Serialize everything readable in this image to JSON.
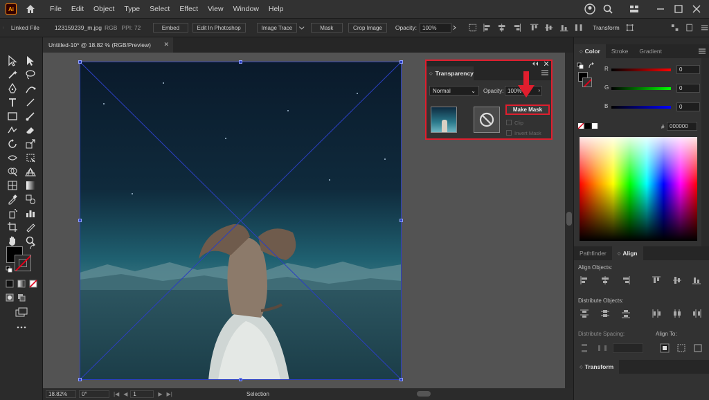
{
  "app": {
    "logo": "Ai"
  },
  "menu": [
    "File",
    "Edit",
    "Object",
    "Type",
    "Select",
    "Effect",
    "View",
    "Window",
    "Help"
  ],
  "controlbar": {
    "linked_file": "Linked File",
    "filename": "123159239_m.jpg",
    "color_mode": "RGB",
    "ppi": "PPI: 72",
    "embed": "Embed",
    "edit_photoshop": "Edit In Photoshop",
    "image_trace": "Image Trace",
    "mask": "Mask",
    "crop_image": "Crop Image",
    "opacity_label": "Opacity:",
    "opacity_value": "100%",
    "transform": "Transform"
  },
  "document": {
    "tab_title": "Untitled-10* @ 18.82 % (RGB/Preview)",
    "close": "✕"
  },
  "statusbar": {
    "zoom": "18.82%",
    "rotation": "0°",
    "artboard": "1",
    "tool": "Selection"
  },
  "transparency": {
    "title": "Transparency",
    "blend_mode": "Normal",
    "opacity_label": "Opacity:",
    "opacity_value": "100%",
    "make_mask": "Make Mask",
    "clip": "Clip",
    "invert_mask": "Invert Mask"
  },
  "color_panel": {
    "tabs": [
      "Color",
      "Stroke",
      "Gradient"
    ],
    "r_label": "R",
    "r_value": "0",
    "g_label": "G",
    "g_value": "0",
    "b_label": "B",
    "b_value": "0",
    "hex_label": "#",
    "hex_value": "000000"
  },
  "align_panel": {
    "tabs": [
      "Pathfinder",
      "Align"
    ],
    "align_objects": "Align Objects:",
    "distribute_objects": "Distribute Objects:",
    "distribute_spacing": "Distribute Spacing:",
    "align_to": "Align To:"
  },
  "transform_panel": {
    "title": "Transform"
  },
  "colors": {
    "highlight": "#e01e2e",
    "selection": "#2b3fc0",
    "accent": "#ff9a00"
  }
}
